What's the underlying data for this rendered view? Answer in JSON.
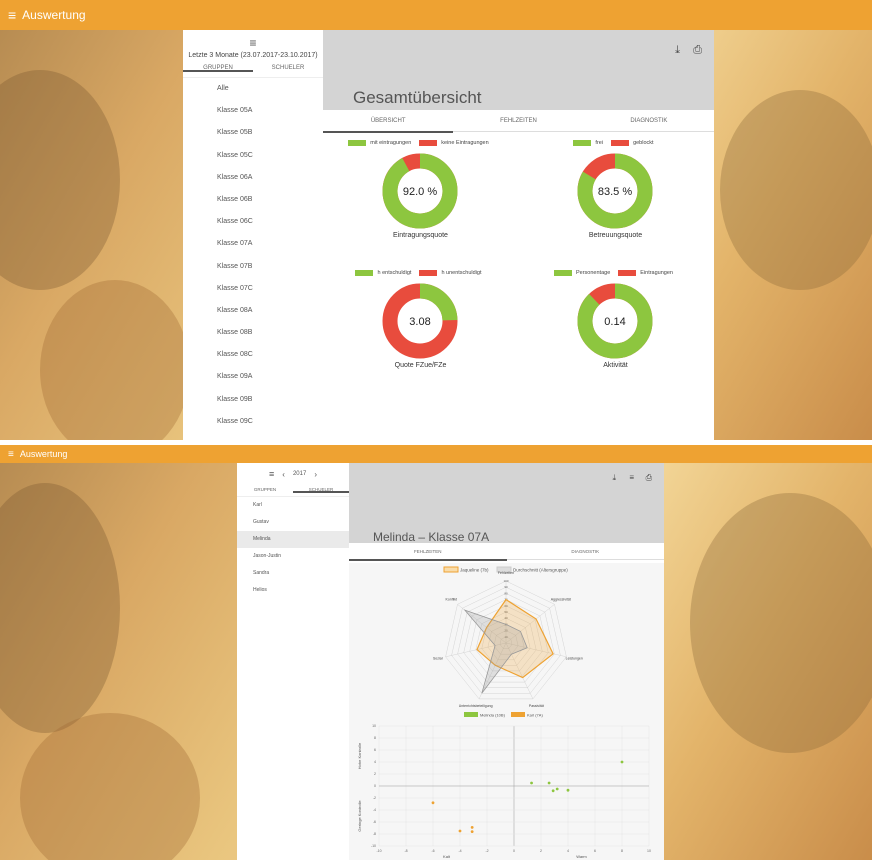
{
  "top": {
    "app_title": "Auswertung",
    "date_range": "Letzte 3 Monate (23.07.2017-23.10.2017)",
    "sidebar_tabs": [
      "GRUPPEN",
      "SCHUELER"
    ],
    "groups": [
      "Alle",
      "Klasse 05A",
      "Klasse 05B",
      "Klasse 05C",
      "Klasse 06A",
      "Klasse 06B",
      "Klasse 06C",
      "Klasse 07A",
      "Klasse 07B",
      "Klasse 07C",
      "Klasse 08A",
      "Klasse 08B",
      "Klasse 08C",
      "Klasse 09A",
      "Klasse 09B",
      "Klasse 09C"
    ],
    "title": "Gesamtübersicht",
    "tabs": [
      "ÜBERSICHT",
      "FEHLZEITEN",
      "DIAGNOSTIK"
    ],
    "donuts": [
      {
        "legend": [
          "mit eintragungen",
          "keine Eintragungen"
        ],
        "value": 92.0,
        "center": "92.0 %",
        "label": "Eintragungsquote"
      },
      {
        "legend": [
          "frei",
          "geblockt"
        ],
        "value": 83.5,
        "center": "83.5 %",
        "label": "Betreuungsquote"
      },
      {
        "legend": [
          "h entschuldigt",
          "h unentschuldigt"
        ],
        "value": 24.5,
        "center": "3.08",
        "label": "Quote FZue/FZe"
      },
      {
        "legend": [
          "Personentage",
          "Eintragungen"
        ],
        "value": 87.7,
        "center": "0.14",
        "label": "Aktivität"
      }
    ],
    "colors": {
      "green": "#8dc63f",
      "red": "#e84c3d",
      "orange": "#eea232"
    }
  },
  "bottom": {
    "app_title": "Auswertung",
    "year": "2017",
    "sidebar_tabs": [
      "GRUPPEN",
      "SCHUELER"
    ],
    "students": [
      "Karl",
      "Gustav",
      "Melinda",
      "Jason-Justin",
      "Sandra",
      "Helios"
    ],
    "selected_student": "Melinda",
    "title": "Melinda – Klasse 07A",
    "tabs": [
      "FEHLZEITEN",
      "DIAGNOSTIK"
    ],
    "radar_legend": [
      "Jaqueline (7b)",
      "Durchschnitt (Altersgruppe)"
    ],
    "scatter_legend": [
      "Melinda (10B)",
      "Karl (7A)"
    ],
    "scatter_xlabel_left": "Kalt",
    "scatter_xlabel_right": "Warm",
    "scatter_ylabel_top": "Hohe Kontrolle",
    "scatter_ylabel_bottom": "Geringe Kontrolle"
  },
  "chart_data": [
    {
      "type": "radar",
      "axes": [
        "Fehlzeiten",
        "Aggressivität",
        "Leistungen",
        "Passivität",
        "Unterrichtsbeteiligung",
        "Sozial",
        "Konflikt"
      ],
      "scale_ticks": [
        10,
        20,
        30,
        40,
        50,
        60,
        70,
        80,
        90,
        100
      ],
      "rlim": [
        0,
        100
      ],
      "series": [
        {
          "name": "Jaqueline (7b)",
          "values": [
            70,
            62,
            78,
            62,
            40,
            48,
            40
          ]
        },
        {
          "name": "Durchschnitt (Altersgruppe)",
          "values": [
            30,
            30,
            35,
            20,
            90,
            18,
            85
          ]
        }
      ]
    },
    {
      "type": "scatter",
      "xlim": [
        -10,
        10
      ],
      "ylim": [
        -10,
        10
      ],
      "xticks": [
        -10,
        -8,
        -6,
        -4,
        -2,
        0,
        2,
        4,
        6,
        8,
        10
      ],
      "yticks": [
        -10,
        -8,
        -6,
        -4,
        -2,
        0,
        2,
        4,
        6,
        8,
        10
      ],
      "series": [
        {
          "name": "Melinda (10B)",
          "points": [
            [
              1.3,
              0.5
            ],
            [
              2.6,
              0.5
            ],
            [
              2.9,
              -0.8
            ],
            [
              3.2,
              -0.5
            ],
            [
              4.0,
              -0.7
            ],
            [
              8.0,
              4.0
            ]
          ]
        },
        {
          "name": "Karl (7A)",
          "points": [
            [
              -6,
              -2.8
            ],
            [
              -4,
              -7.5
            ],
            [
              -3.1,
              -6.9
            ],
            [
              -3.1,
              -7.6
            ]
          ]
        }
      ]
    }
  ]
}
